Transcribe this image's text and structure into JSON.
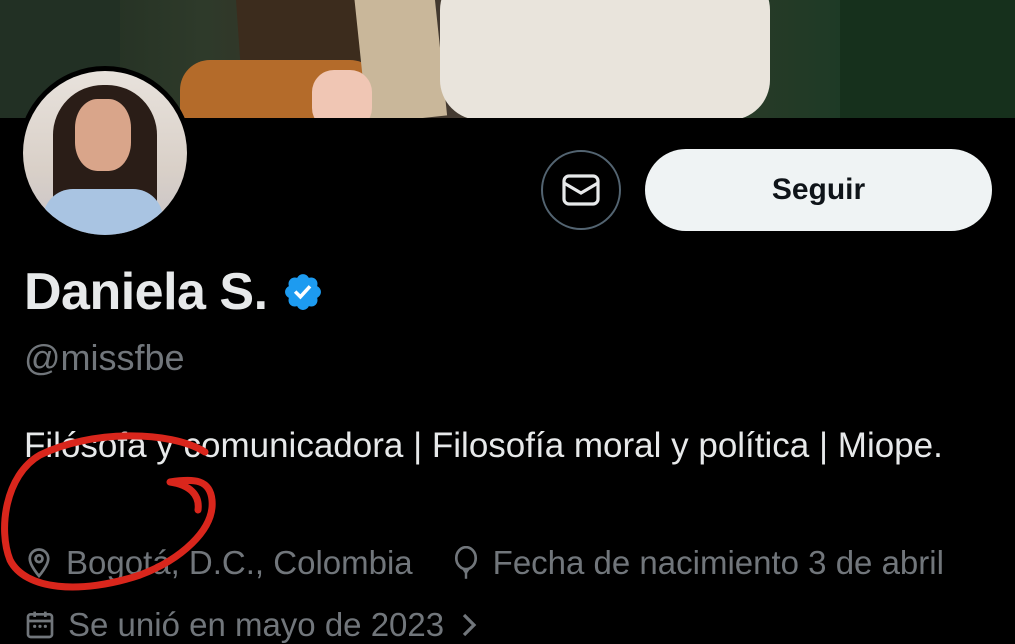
{
  "profile": {
    "display_name": "Daniela S.",
    "handle": "@missfbe",
    "bio": "Filósofa y comunicadora | Filosofía moral y política | Miope.",
    "location": "Bogotá, D.C., Colombia",
    "birthday": "Fecha de nacimiento 3 de abril",
    "joined": "Se unió en mayo de 2023"
  },
  "actions": {
    "follow_label": "Seguir"
  },
  "icons": {
    "message": "envelope-icon",
    "verified": "verified-badge-icon",
    "location": "location-pin-icon",
    "birthday": "balloon-icon",
    "joined": "calendar-icon",
    "joined_chevron": "chevron-right-icon"
  },
  "colors": {
    "background": "#000000",
    "text_primary": "#e7e9ea",
    "text_secondary": "#71767b",
    "verified_blue": "#1d9bf0",
    "annotation_red": "#d9261c",
    "button_bg": "#eff3f4"
  }
}
